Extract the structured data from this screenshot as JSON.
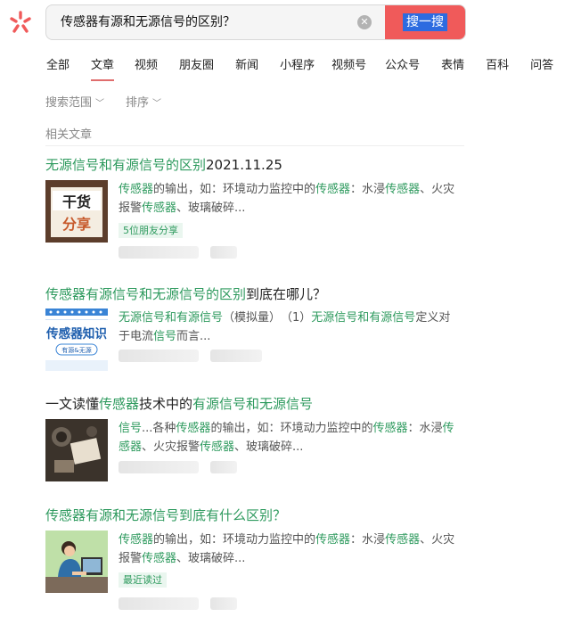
{
  "search": {
    "query": "传感器有源和无源信号的区别？",
    "button_label": "搜一搜"
  },
  "tabs": [
    {
      "label": "全部"
    },
    {
      "label": "文章"
    },
    {
      "label": "视频"
    },
    {
      "label": "朋友圈"
    },
    {
      "label": "新闻"
    },
    {
      "label": "小程序"
    },
    {
      "label": "视频号"
    },
    {
      "label": "公众号"
    },
    {
      "label": "表情"
    },
    {
      "label": "百科"
    },
    {
      "label": "问答"
    }
  ],
  "active_tab": "文章",
  "filters": {
    "range_label": "搜索范围",
    "sort_label": "排序"
  },
  "section_label": "相关文章",
  "articles": [
    {
      "title_parts": [
        "无源信号和有源信号的区别",
        "2021.11.25"
      ],
      "snippet_parts": [
        "传感器",
        "的输出，如：环境动力监控中的",
        "传感器",
        "：水浸",
        "传感器",
        "、火灾报警",
        "传感器",
        "、玻璃破碎..."
      ],
      "badge": "5位朋友分享",
      "thumb_text": [
        "干货",
        "分享"
      ]
    },
    {
      "title_parts": [
        "传感器有源信号和无源信号的区别",
        "到底在哪儿？"
      ],
      "snippet_parts": [
        "无源信号和有源信号",
        "（模拟量）　（1）",
        "无源信号和有源信号",
        "定义对于电流",
        "信号",
        "而言..."
      ],
      "thumb_text": [
        "传感器知识",
        "有源&无源"
      ]
    },
    {
      "title_parts": [
        "一文读懂",
        "传感器",
        "技术中的",
        "有源信号和无源信号"
      ],
      "snippet_parts": [
        "信号",
        "...各种",
        "传感器",
        "的输出，如：环境动力监控中的",
        "传感器",
        "：水浸",
        "传感器",
        "、火灾报警",
        "传感器",
        "、玻璃破碎..."
      ]
    },
    {
      "title_parts": [
        "传感器有源和无源信号到底有什么区别？"
      ],
      "snippet_parts": [
        "传感器",
        "的输出，如：环境动力监控中的",
        "传感器",
        "：水浸",
        "传感器",
        "、火灾报警",
        "传感器",
        "、玻璃破碎..."
      ],
      "badge": "最近读过"
    }
  ],
  "colors": {
    "accent": "#f05a5a",
    "highlight": "#2e9a5e",
    "selection": "#2d6be0"
  }
}
